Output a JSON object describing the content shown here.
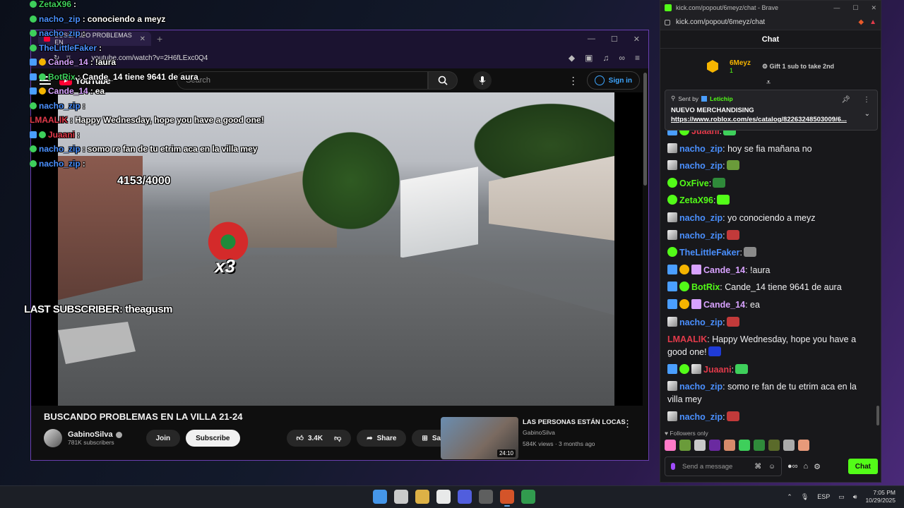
{
  "overlay_chat": [
    {
      "user": "ZetaX96",
      "sep": ":",
      "msg": "",
      "badges": [
        "ver"
      ],
      "color": "#3ecf5b"
    },
    {
      "user": "nacho_zip",
      "sep": ":",
      "msg": "conociendo a meyz",
      "badges": [
        "ver"
      ],
      "color": "#4a90ff"
    },
    {
      "user": "nacho_zip",
      "sep": ":",
      "msg": "",
      "badges": [
        "ver"
      ],
      "color": "#4a90ff"
    },
    {
      "user": "TheLittleFaker",
      "sep": ":",
      "msg": "",
      "badges": [
        "ver"
      ],
      "color": "#4a90ff"
    },
    {
      "user": "Cande_14",
      "sep": ":",
      "msg": "!aura",
      "badges": [
        "mod",
        "sub"
      ],
      "color": "#d8a2ff"
    },
    {
      "user": "BotRix",
      "sep": ":",
      "msg": "Cande_14 tiene 9641 de aura",
      "badges": [
        "mod",
        "ver"
      ],
      "color": "#3ecf5b"
    },
    {
      "user": "Cande_14",
      "sep": ":",
      "msg": "ea",
      "badges": [
        "mod",
        "sub"
      ],
      "color": "#d8a2ff"
    },
    {
      "user": "nacho_zip",
      "sep": ":",
      "msg": "",
      "badges": [
        "ver"
      ],
      "color": "#4a90ff"
    },
    {
      "user": "LMAALIK",
      "sep": ":",
      "msg": "Happy Wednesday, hope you have a good one!",
      "badges": [],
      "color": "#e23a4a"
    },
    {
      "user": "Juaani",
      "sep": ":",
      "msg": "",
      "badges": [
        "mod",
        "ver"
      ],
      "color": "#e23a4a"
    },
    {
      "user": "nacho_zip",
      "sep": ":",
      "msg": "somo re fan de tu etrim aca en la villa mey",
      "badges": [
        "ver"
      ],
      "color": "#4a90ff"
    },
    {
      "user": "nacho_zip",
      "sep": ":",
      "msg": "",
      "badges": [
        "ver"
      ],
      "color": "#4a90ff"
    }
  ],
  "youtube": {
    "tab_title": "BUSCANDO PROBLEMAS EN",
    "url": "youtube.com/watch?v=2H6fLExc0Q4",
    "logo_text": "YouTube",
    "search_placeholder": "Search",
    "signin_label": "Sign in",
    "overlay_counter": "4153/4000",
    "overlay_multiplier": "x3",
    "overlay_last_subscriber": "LAST SUBSCRIBER: theagusm",
    "video_title": "BUSCANDO PROBLEMAS EN LA VILLA 21-24",
    "channel_name": "GabinoSilva",
    "subscriber_count": "781K subscribers",
    "join_label": "Join",
    "subscribe_label": "Subscribe",
    "like_count": "3.4K",
    "share_label": "Share",
    "save_label": "Save",
    "rec": {
      "title": "LAS PERSONAS ESTÁN LOCAS",
      "channel": "GabinoSilva",
      "meta": "584K views · 3 months ago",
      "duration": "24:10"
    }
  },
  "kick": {
    "window_title": "kick.com/popout/6meyz/chat - Brave",
    "url": "kick.com/popout/6meyz/chat",
    "chat_header": "Chat",
    "top_gifter": {
      "name": "6Meyz",
      "count": "1"
    },
    "gift_prompt": "Gift 1 sub to take 2nd",
    "pinned": {
      "sent_by_label": "Sent by",
      "user": "Letichip",
      "title": "NUEVO MERCHANDISING",
      "link": "https://www.roblox.com/es/catalog/82263248503009/6..."
    },
    "messages": [
      {
        "user": "Juaani",
        "color": "#e23a4a",
        "text": "",
        "badges": [
          "mod",
          "ver"
        ],
        "emote": "#3ecf5b"
      },
      {
        "user": "nacho_zip",
        "color": "#4a90ff",
        "text": " hoy se fia mañana no",
        "badges": [
          "avatar"
        ],
        "emote": ""
      },
      {
        "user": "nacho_zip",
        "color": "#4a90ff",
        "text": "",
        "badges": [
          "avatar"
        ],
        "emote": "#6a9b3a"
      },
      {
        "user": "OxFive",
        "color": "#53fc18",
        "text": "",
        "badges": [
          "ver"
        ],
        "emote": "#2f8a3a"
      },
      {
        "user": "ZetaX96",
        "color": "#53fc18",
        "text": "",
        "badges": [
          "ver"
        ],
        "emote": "#53fc18"
      },
      {
        "user": "nacho_zip",
        "color": "#4a90ff",
        "text": " yo conociendo a meyz",
        "badges": [
          "avatar"
        ],
        "emote": ""
      },
      {
        "user": "nacho_zip",
        "color": "#4a90ff",
        "text": "",
        "badges": [
          "avatar"
        ],
        "emote": "#c23a3a"
      },
      {
        "user": "TheLittleFaker",
        "color": "#4a90ff",
        "text": "",
        "badges": [
          "ver"
        ],
        "emote": "#8a8a8a"
      },
      {
        "user": "Cande_14",
        "color": "#d8a2ff",
        "text": " !aura",
        "badges": [
          "mod",
          "sub",
          "gift"
        ],
        "emote": ""
      },
      {
        "user": "BotRix",
        "color": "#53fc18",
        "text": " Cande_14 tiene 9641 de aura",
        "badges": [
          "mod",
          "ver"
        ],
        "emote": ""
      },
      {
        "user": "Cande_14",
        "color": "#d8a2ff",
        "text": " ea",
        "badges": [
          "mod",
          "sub",
          "gift"
        ],
        "emote": ""
      },
      {
        "user": "nacho_zip",
        "color": "#4a90ff",
        "text": "",
        "badges": [
          "avatar"
        ],
        "emote": "#c23a3a"
      },
      {
        "user": "LMAALIK",
        "color": "#e23a4a",
        "text": " Happy Wednesday, hope you have a good one!",
        "badges": [],
        "emote": "#1f3bd6"
      },
      {
        "user": "Juaani",
        "color": "#e23a4a",
        "text": "",
        "badges": [
          "mod",
          "ver",
          "avatar"
        ],
        "emote": "#3ecf5b"
      },
      {
        "user": "nacho_zip",
        "color": "#4a90ff",
        "text": " somo re fan de tu etrim aca en la villa mey",
        "badges": [
          "avatar"
        ],
        "emote": ""
      },
      {
        "user": "nacho_zip",
        "color": "#4a90ff",
        "text": "",
        "badges": [
          "avatar"
        ],
        "emote": "#c23a3a"
      }
    ],
    "followers_only_label": "Followers only",
    "quick_emotes": [
      "#ff7ac8",
      "#6a9b3a",
      "#c8c8c8",
      "#6a2aa0",
      "#d88a6a",
      "#3ecf5b",
      "#2f8a3a",
      "#5a6a2a",
      "#aaaaaa",
      "#e89a7a"
    ],
    "input_placeholder": "Send a message",
    "chat_button": "Chat"
  },
  "taskbar": {
    "apps": [
      {
        "name": "start-icon",
        "color": "#4aa3ff"
      },
      {
        "name": "search-taskbar-icon",
        "color": "#dddddd"
      },
      {
        "name": "file-explorer-icon",
        "color": "#f3c14a"
      },
      {
        "name": "store-icon",
        "color": "#ffffff"
      },
      {
        "name": "discord-icon",
        "color": "#5865f2"
      },
      {
        "name": "obs-icon",
        "color": "#666666"
      },
      {
        "name": "brave-icon",
        "color": "#e85a2a"
      },
      {
        "name": "chrome-icon",
        "color": "#34a853"
      }
    ],
    "language": "ESP",
    "time": "7:05 PM",
    "date": "10/29/2025"
  }
}
